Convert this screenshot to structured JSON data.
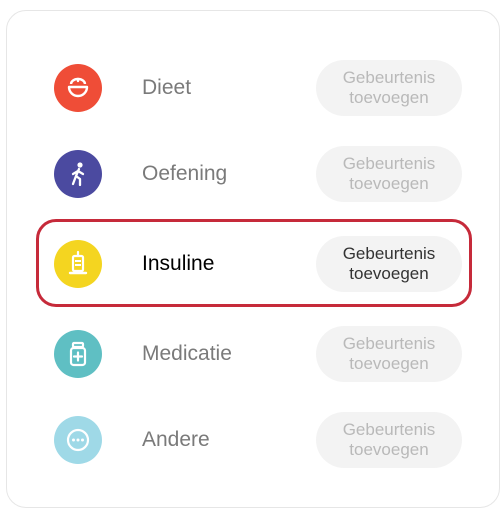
{
  "events": [
    {
      "id": "diet",
      "label": "Dieet",
      "button": "Gebeurtenis\ntoevoegen",
      "icon": "bowl-icon",
      "color": "#ef4d37",
      "selected": false
    },
    {
      "id": "exercise",
      "label": "Oefening",
      "button": "Gebeurtenis\ntoevoegen",
      "icon": "walking-person-icon",
      "color": "#4b4aa0",
      "selected": false
    },
    {
      "id": "insulin",
      "label": "Insuline",
      "button": "Gebeurtenis\ntoevoegen",
      "icon": "syringe-icon",
      "color": "#f4d520",
      "selected": true
    },
    {
      "id": "medication",
      "label": "Medicatie",
      "button": "Gebeurtenis\ntoevoegen",
      "icon": "pill-bottle-icon",
      "color": "#2aaab0",
      "selected": false
    },
    {
      "id": "other",
      "label": "Andere",
      "button": "Gebeurtenis\ntoevoegen",
      "icon": "more-dots-icon",
      "color": "#7fcde0",
      "selected": false
    }
  ]
}
